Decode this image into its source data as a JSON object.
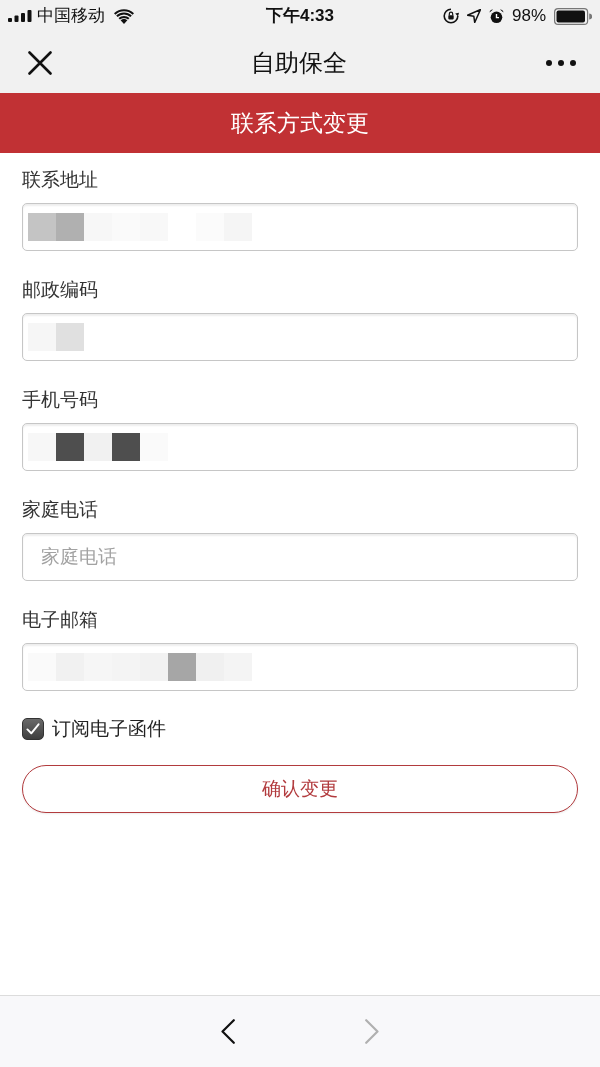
{
  "status_bar": {
    "carrier": "中国移动",
    "time": "下午4:33",
    "battery": "98%"
  },
  "nav_bar": {
    "title": "自助保全"
  },
  "banner": {
    "title": "联系方式变更"
  },
  "form": {
    "fields": [
      {
        "label": "联系地址",
        "redacted": true
      },
      {
        "label": "邮政编码",
        "redacted": true
      },
      {
        "label": "手机号码",
        "redacted": true
      },
      {
        "label": "家庭电话",
        "placeholder": "家庭电话",
        "redacted": false
      },
      {
        "label": "电子邮箱",
        "redacted": true
      }
    ],
    "subscribe": {
      "label": "订阅电子函件",
      "checked": true
    },
    "submit_button": {
      "label": "确认变更"
    }
  },
  "toolbar": {
    "back": {
      "disabled": false
    },
    "forward": {
      "disabled": true
    }
  }
}
